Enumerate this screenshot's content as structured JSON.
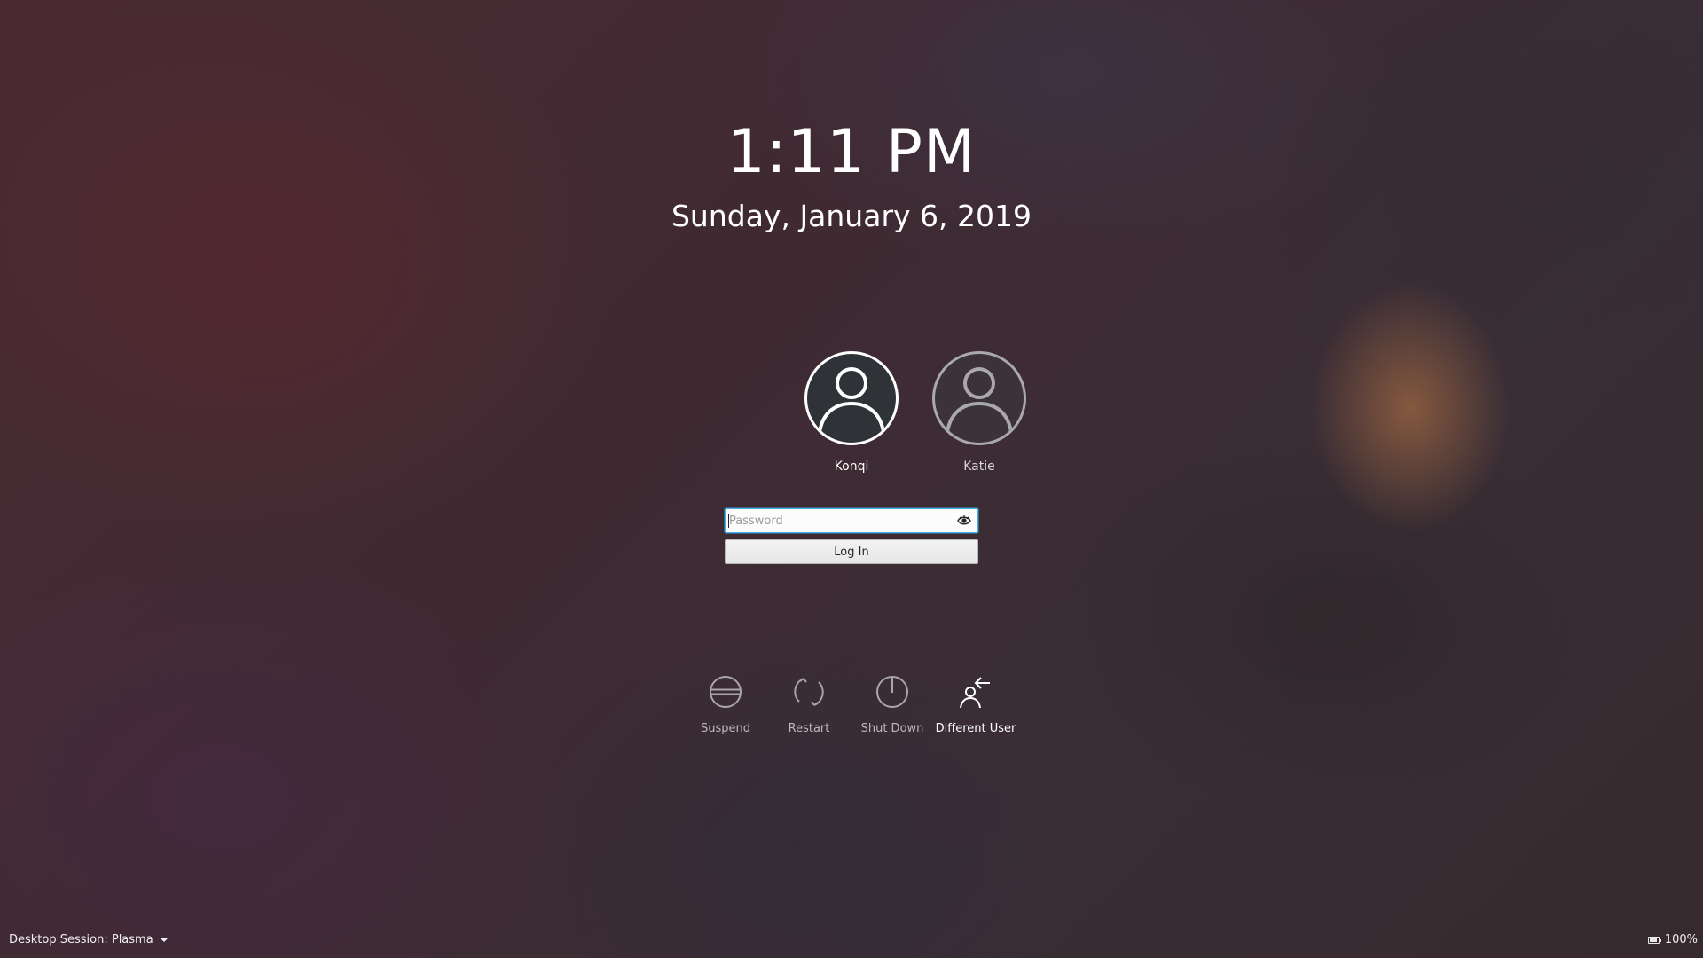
{
  "lockscreen": {
    "time": "1:11 PM",
    "date": "Sunday, January 6, 2019"
  },
  "users": [
    {
      "name": "Konqi",
      "selected": true,
      "icon": "user-avatar-icon"
    },
    {
      "name": "Katie",
      "selected": false,
      "icon": "user-avatar-icon"
    }
  ],
  "login": {
    "password_placeholder": "Password",
    "password_value": "",
    "login_label": "Log In",
    "reveal_icon": "eye-icon",
    "accent": "#3daee9"
  },
  "actions": [
    {
      "label": "Suspend",
      "icon": "suspend-icon",
      "enabled": false
    },
    {
      "label": "Restart",
      "icon": "restart-icon",
      "enabled": false
    },
    {
      "label": "Shut Down",
      "icon": "power-icon",
      "enabled": false
    },
    {
      "label": "Different User",
      "icon": "switch-user-icon",
      "enabled": true
    }
  ],
  "footer": {
    "session_label": "Desktop Session: Plasma",
    "battery_label": "100%",
    "battery_icon": "battery-icon"
  }
}
